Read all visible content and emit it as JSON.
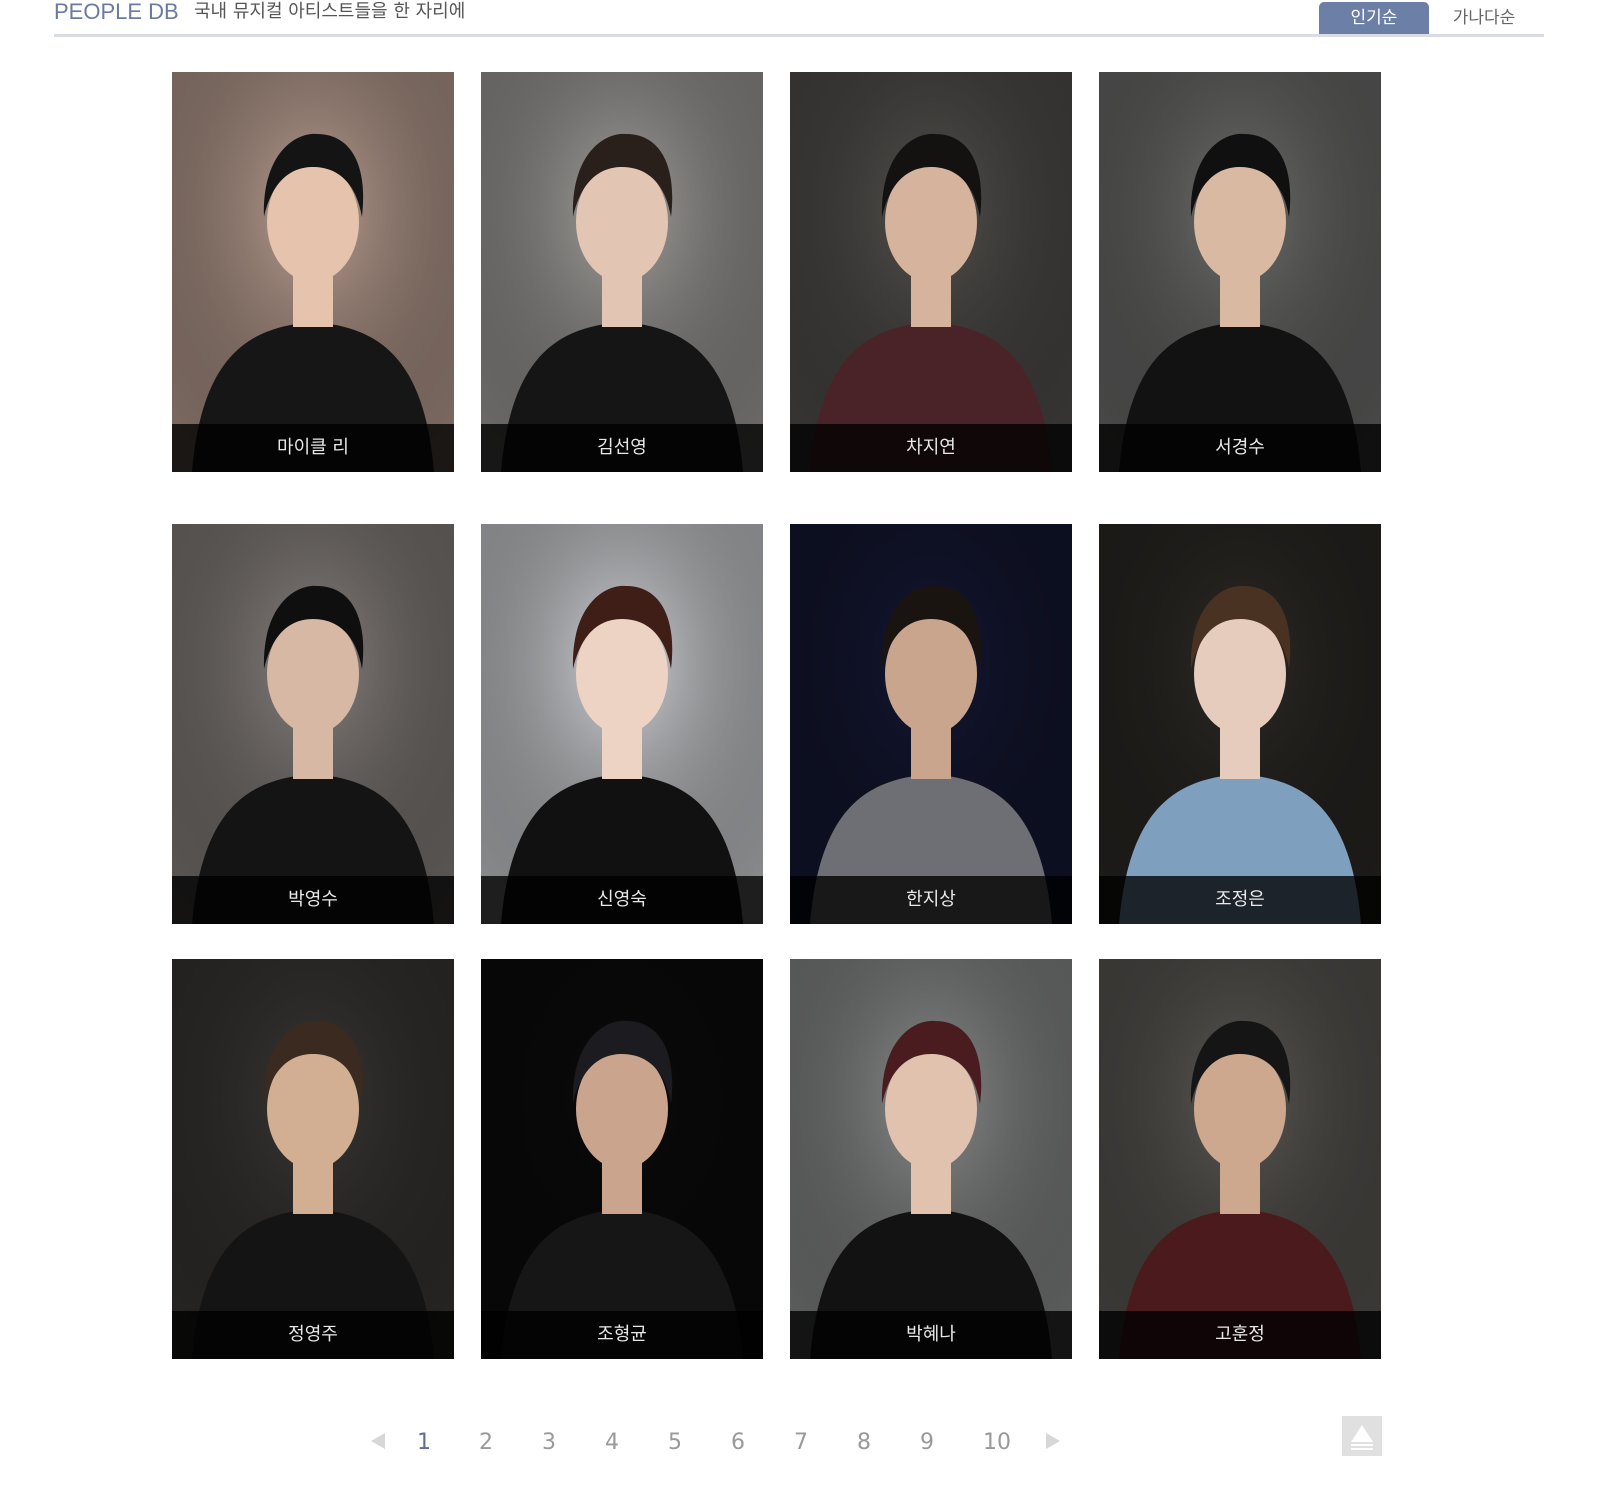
{
  "header": {
    "brand": "PEOPLE DB",
    "tagline": "국내 뮤지컬 아티스트들을 한 자리에",
    "sort_tabs": [
      {
        "label": "인기순",
        "active": true
      },
      {
        "label": "가나다순",
        "active": false
      }
    ]
  },
  "artists": [
    {
      "name": "마이클 리",
      "bg": "#bfa395",
      "tone": "#e6c3ad",
      "outfit": "#161616",
      "hair": "#141414"
    },
    {
      "name": "김선영",
      "bg": "#a6a3a0",
      "tone": "#e2c6b3",
      "outfit": "#151515",
      "hair": "#2a201b"
    },
    {
      "name": "차지연",
      "bg": "#55524f",
      "tone": "#d6b39c",
      "outfit": "#4a2328",
      "hair": "#141111"
    },
    {
      "name": "서경수",
      "bg": "#6f706e",
      "tone": "#d9b9a2",
      "outfit": "#121212",
      "hair": "#101010"
    },
    {
      "name": "박영수",
      "bg": "#8a8480",
      "tone": "#d7b8a4",
      "outfit": "#141414",
      "hair": "#0f0f0f"
    },
    {
      "name": "신영숙",
      "bg": "#d4d5d9",
      "tone": "#edd3c4",
      "outfit": "#111111",
      "hair": "#3e1e17"
    },
    {
      "name": "한지상",
      "bg": "#141833",
      "tone": "#caa58e",
      "outfit": "#6d6f74",
      "hair": "#1a1410"
    },
    {
      "name": "조정은",
      "bg": "#2d2a26",
      "tone": "#e6ccbc",
      "outfit": "#7e9fbd",
      "hair": "#4a3222"
    },
    {
      "name": "정영주",
      "bg": "#3a3835",
      "tone": "#d2ae93",
      "outfit": "#141414",
      "hair": "#3b2a20"
    },
    {
      "name": "조형균",
      "bg": "#0c0b0c",
      "tone": "#caa48d",
      "outfit": "#161616",
      "hair": "#1b1b20"
    },
    {
      "name": "박혜나",
      "bg": "#8d8e8e",
      "tone": "#e0c2ae",
      "outfit": "#121212",
      "hair": "#4a1c1f"
    },
    {
      "name": "고훈정",
      "bg": "#5c5955",
      "tone": "#cda88f",
      "outfit": "#4b1a1d",
      "hair": "#151515"
    }
  ],
  "pagination": {
    "pages": [
      "1",
      "2",
      "3",
      "4",
      "5",
      "6",
      "7",
      "8",
      "9",
      "10"
    ],
    "current": "1"
  },
  "colors": {
    "accent": "#6c7fa6",
    "name_bar": "rgba(0,0,0,0.78)"
  },
  "icons": {
    "prev": "prev-page-icon",
    "next": "next-page-icon",
    "top": "scroll-top-icon"
  }
}
